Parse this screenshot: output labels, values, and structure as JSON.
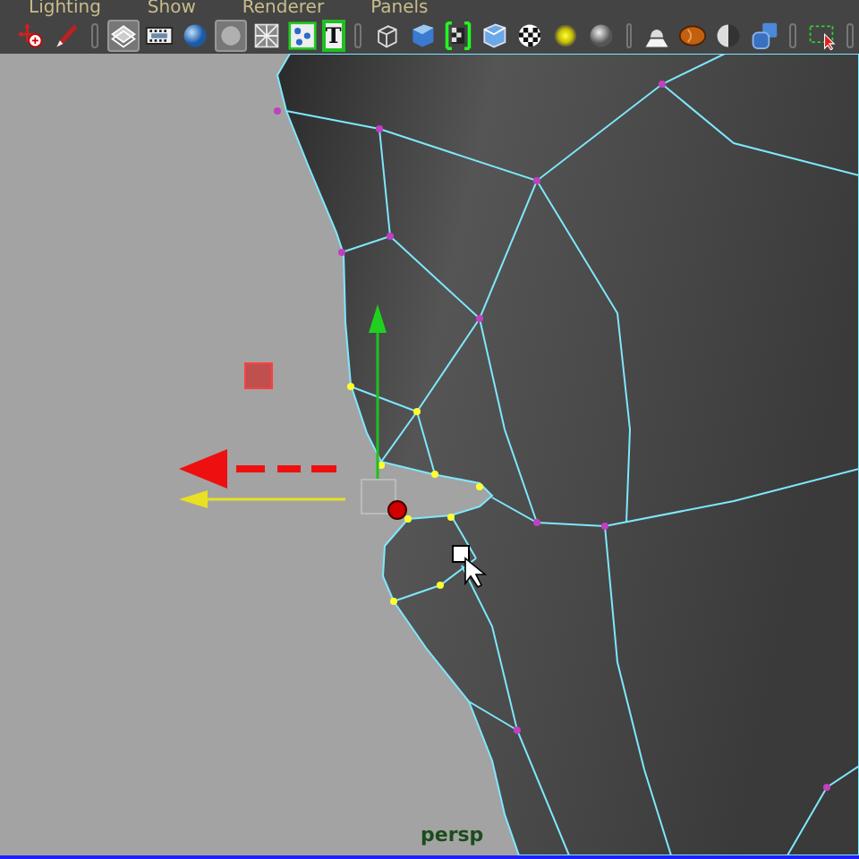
{
  "menu": [
    "Lighting",
    "Show",
    "Renderer",
    "Panels"
  ],
  "toolbar": [
    {
      "kind": "move-tool",
      "selected": false
    },
    {
      "kind": "paint-brush",
      "selected": false
    },
    {
      "kind": "separator"
    },
    {
      "kind": "wireframe-shaded",
      "selected": true
    },
    {
      "kind": "film-strip",
      "selected": false
    },
    {
      "kind": "blue-sphere",
      "selected": false
    },
    {
      "kind": "gray-circle",
      "selected": true
    },
    {
      "kind": "xray-grid",
      "selected": false
    },
    {
      "kind": "component-dots",
      "selected": false
    },
    {
      "kind": "text",
      "glyph": "T",
      "selected": false
    },
    {
      "kind": "separator"
    },
    {
      "kind": "wire-cube",
      "selected": false
    },
    {
      "kind": "blue-cube",
      "selected": false
    },
    {
      "kind": "checker-cube",
      "selected": false
    },
    {
      "kind": "light-cube",
      "selected": false
    },
    {
      "kind": "checker-ball",
      "selected": false
    },
    {
      "kind": "yellow-light",
      "selected": false
    },
    {
      "kind": "gray-sphere",
      "selected": false
    },
    {
      "kind": "separator"
    },
    {
      "kind": "lamp",
      "selected": false
    },
    {
      "kind": "orange-ball",
      "selected": false
    },
    {
      "kind": "half-sphere",
      "selected": false
    },
    {
      "kind": "blue-cubes",
      "selected": false
    },
    {
      "kind": "separator"
    },
    {
      "kind": "marquee-select",
      "selected": false
    },
    {
      "kind": "separator"
    }
  ],
  "viewport": {
    "camera_label": "persp"
  }
}
